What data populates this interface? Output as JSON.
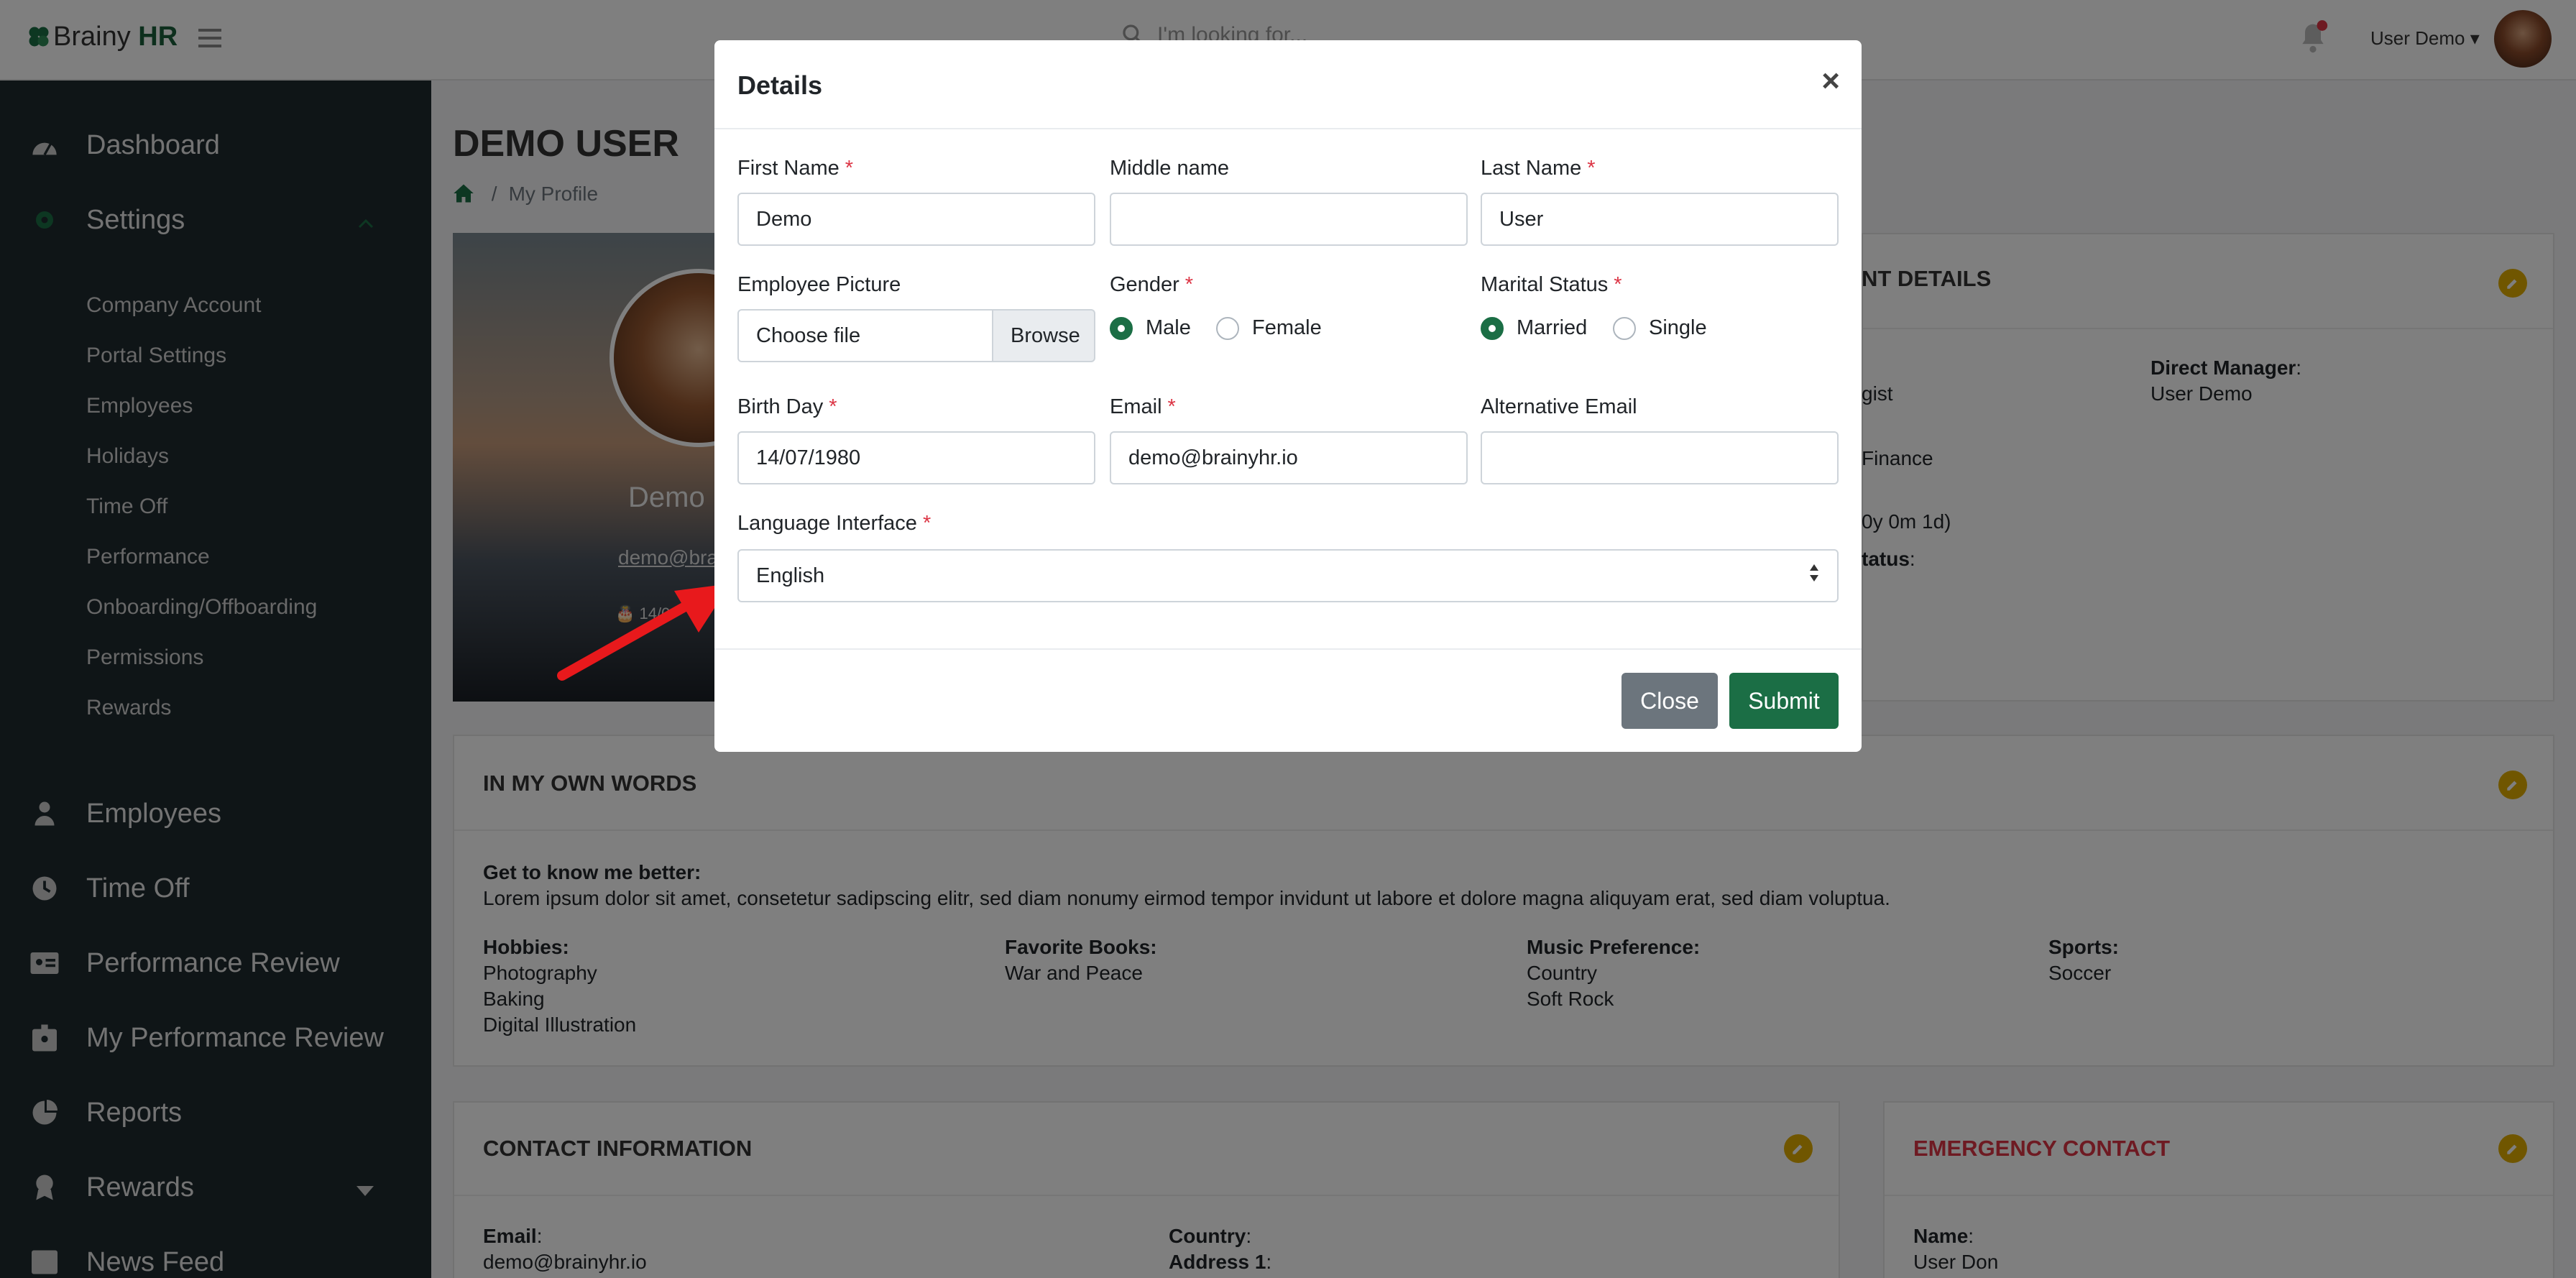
{
  "app": {
    "brand_light": "Brainy",
    "brand_bold": "HR",
    "search_placeholder": "I'm looking for...",
    "user_label": "User Demo"
  },
  "sidebar": {
    "items": [
      {
        "label": "Dashboard",
        "icon": "dashboard-icon"
      },
      {
        "label": "Settings",
        "icon": "gear-icon"
      },
      {
        "label": "Employees",
        "icon": "person-icon"
      },
      {
        "label": "Time Off",
        "icon": "clock-icon"
      },
      {
        "label": "Performance Review",
        "icon": "id-card-icon"
      },
      {
        "label": "My Performance Review",
        "icon": "badge-icon"
      },
      {
        "label": "Reports",
        "icon": "pie-chart-icon"
      },
      {
        "label": "Rewards",
        "icon": "award-icon"
      },
      {
        "label": "News Feed",
        "icon": "newspaper-icon"
      }
    ],
    "settings_sub": [
      "Company Account",
      "Portal Settings",
      "Employees",
      "Holidays",
      "Time Off",
      "Performance",
      "Onboarding/Offboarding",
      "Permissions",
      "Rewards"
    ]
  },
  "page": {
    "title": "DEMO USER",
    "breadcrumb_sep": "/",
    "breadcrumb": "My Profile",
    "profile_name": "Demo U",
    "profile_email": "demo@bra",
    "profile_date": "14/0",
    "employment_title_fragment": "NT DETAILS",
    "employment": {
      "dm_label": "Direct Manager",
      "dm_value": "User Demo",
      "frag1": "gist",
      "frag2": "Finance",
      "frag3": "0y 0m 1d)",
      "frag4": "tatus"
    }
  },
  "own_words": {
    "title": "IN MY OWN WORDS",
    "know_label": "Get to know me better:",
    "know_text": "Lorem ipsum dolor sit amet, consetetur sadipscing elitr, sed diam nonumy eirmod tempor invidunt ut labore et dolore magna aliquyam erat, sed diam voluptua.",
    "hobbies_label": "Hobbies:",
    "hobbies": [
      "Photography",
      "Baking",
      "Digital Illustration"
    ],
    "books_label": "Favorite Books:",
    "books": [
      "War and Peace"
    ],
    "music_label": "Music Preference:",
    "music": [
      "Country",
      "Soft Rock"
    ],
    "sports_label": "Sports:",
    "sports": [
      "Soccer"
    ]
  },
  "contact": {
    "title": "CONTACT INFORMATION",
    "email_label": "Email",
    "email": "demo@brainyhr.io",
    "country_label": "Country",
    "address_label": "Address 1"
  },
  "emergency": {
    "title": "EMERGENCY CONTACT",
    "name_label": "Name",
    "name": "User Don"
  },
  "modal": {
    "title": "Details",
    "first_name_label": "First Name",
    "first_name": "Demo",
    "middle_name_label": "Middle name",
    "middle_name": "",
    "last_name_label": "Last Name",
    "last_name": "User",
    "picture_label": "Employee Picture",
    "picture_placeholder": "Choose file",
    "browse": "Browse",
    "gender_label": "Gender",
    "gender_options": [
      "Male",
      "Female"
    ],
    "gender_selected": "Male",
    "marital_label": "Marital Status",
    "marital_options": [
      "Married",
      "Single"
    ],
    "marital_selected": "Married",
    "birthday_label": "Birth Day",
    "birthday": "14/07/1980",
    "email_label": "Email",
    "email": "demo@brainyhr.io",
    "alt_email_label": "Alternative Email",
    "alt_email": "",
    "language_label": "Language Interface",
    "language": "English",
    "close": "Close",
    "submit": "Submit"
  },
  "colors": {
    "brand_green": "#1b6e45",
    "sidebar_bg": "#1f2a2f",
    "close_btn": "#6c757d",
    "required": "#dc3545",
    "edit_badge": "#e0ac00",
    "emergency_title": "#dc3545"
  }
}
